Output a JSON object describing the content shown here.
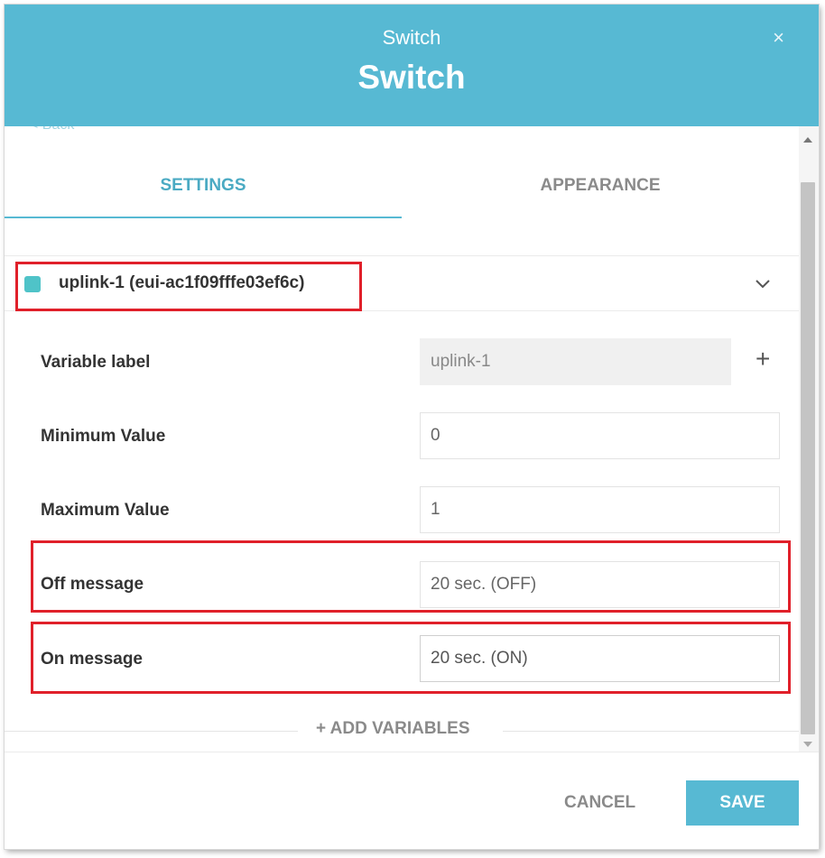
{
  "header": {
    "subtitle": "Switch",
    "title": "Switch",
    "close_glyph": "×"
  },
  "back_link": "< Back",
  "tabs": [
    {
      "label": "SETTINGS",
      "active": true
    },
    {
      "label": "APPEARANCE",
      "active": false
    }
  ],
  "variable": {
    "name": "uplink-1 (eui-ac1f09fffe03ef6c)",
    "color": "#4fc3c8"
  },
  "fields": {
    "variable_label": {
      "label": "Variable label",
      "value": "uplink-1"
    },
    "minimum_value": {
      "label": "Minimum Value",
      "value": "0"
    },
    "maximum_value": {
      "label": "Maximum Value",
      "value": "1"
    },
    "off_message": {
      "label": "Off message",
      "value": "20 sec. (OFF)"
    },
    "on_message": {
      "label": "On message",
      "value": "20 sec. (ON)"
    }
  },
  "add_variables_label": "+ ADD VARIABLES",
  "footer": {
    "cancel_label": "CANCEL",
    "save_label": "SAVE"
  },
  "colors": {
    "accent": "#57b9d3",
    "highlight": "#e0202a"
  },
  "icons": {
    "close": "close-icon",
    "chevron": "chevron-down-icon",
    "plus": "plus-icon"
  }
}
